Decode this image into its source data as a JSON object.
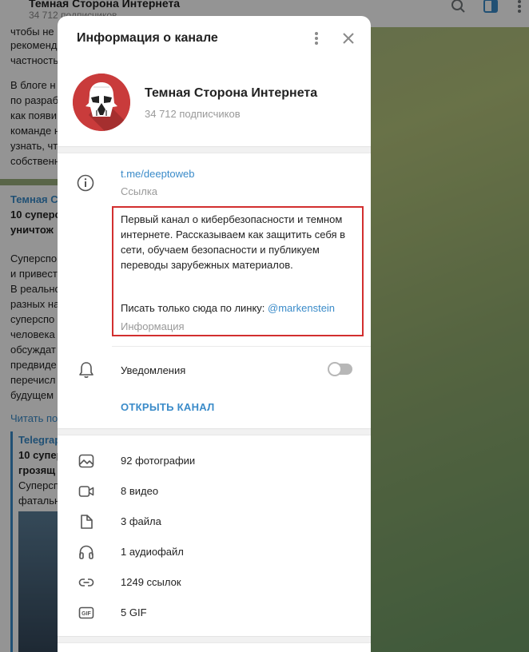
{
  "background": {
    "chat_title": "Темная Сторона Интернета",
    "chat_subtitle": "34 712 подписчиков",
    "snippets": [
      "чтобы не",
      "рекоменд",
      "частность",
      "",
      "В блоге н",
      "по разраб",
      "как появи",
      "команде н",
      "узнать, чт",
      "собственн"
    ],
    "msg_channel": "Темная С",
    "msg_title1": "10 суперс",
    "msg_title2": "уничтож",
    "msg_body": [
      "Суперспо",
      "и привест",
      "В реально",
      "разных на",
      "суперспо",
      "человека",
      "обсуждат",
      "предвиде",
      "перечисл",
      "будущем"
    ],
    "read_more": "Читать по",
    "telegraph_label": "Telegrap",
    "telegraph_title1": "10 суперс",
    "telegraph_title2": "грозящ",
    "telegraph_body1": "Суперсп",
    "telegraph_body2": "фатальн"
  },
  "dialog": {
    "title": "Информация о канале",
    "more_icon": "more-vertical-icon",
    "close_icon": "close-icon",
    "channel": {
      "name": "Темная Сторона Интернета",
      "subscribers": "34 712 подписчиков",
      "avatar_color": "#c93b3b"
    },
    "link": {
      "url": "t.me/deeptoweb",
      "label": "Ссылка"
    },
    "description": {
      "text": "Первый канал о кибербезопасности и темном интернете. Рассказываем как защитить себя в сети, обучаем безопасности и публикуем переводы зарубежных материалов.",
      "contact_prefix": "Писать только сюда по линку: ",
      "contact_mention": "@markenstein",
      "label": "Информация",
      "highlight_color": "#d22f2f"
    },
    "notifications": {
      "label": "Уведомления",
      "enabled": false
    },
    "open_channel": "ОТКРЫТЬ КАНАЛ",
    "media": [
      {
        "icon": "photo-icon",
        "label": "92 фотографии"
      },
      {
        "icon": "video-icon",
        "label": "8 видео"
      },
      {
        "icon": "file-icon",
        "label": "3 файла"
      },
      {
        "icon": "headphones-icon",
        "label": "1 аудиофайл"
      },
      {
        "icon": "link-icon",
        "label": "1249 ссылок"
      },
      {
        "icon": "gif-icon",
        "label": "5 GIF"
      }
    ],
    "accent_color": "#3a8bc9"
  }
}
